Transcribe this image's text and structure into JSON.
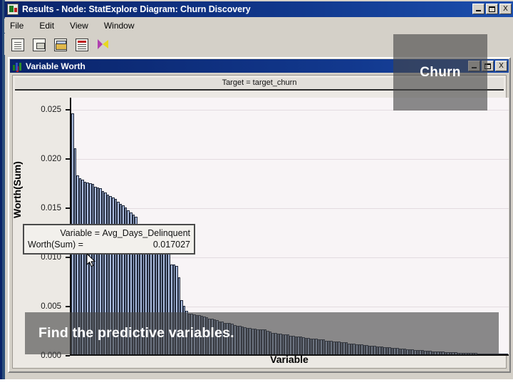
{
  "window": {
    "title": "Results - Node: StatExplore  Diagram: Churn Discovery",
    "icon": "results-node-icon",
    "buttons": {
      "minimize": "_",
      "maximize": "□",
      "close": "X"
    }
  },
  "menubar": {
    "items": [
      {
        "label": "File"
      },
      {
        "label": "Edit"
      },
      {
        "label": "View"
      },
      {
        "label": "Window"
      }
    ]
  },
  "toolbar": {
    "buttons": [
      {
        "name": "new-document-button",
        "icon": "document-icon"
      },
      {
        "name": "save-button",
        "icon": "save-icon"
      },
      {
        "name": "print-button",
        "icon": "printer-icon"
      },
      {
        "name": "table-view-button",
        "icon": "table-icon"
      },
      {
        "name": "run-button",
        "icon": "lightning-bolt-icon"
      }
    ]
  },
  "inner_window": {
    "title": "Variable Worth",
    "icon": "bar-chart-icon",
    "buttons": {
      "minimize": "_",
      "maximize": "□",
      "close": "X"
    }
  },
  "tooltip": {
    "variable_label": "Variable =",
    "variable_value": "Avg_Days_Delinquent",
    "worth_label": "Worth(Sum) =",
    "worth_value": "0.017027"
  },
  "overlays": [
    {
      "name": "overlay-churn",
      "text": "Churn",
      "color": "#464646"
    },
    {
      "name": "overlay-find-predictive",
      "text": "Find the predictive variables.",
      "color": "#464646"
    }
  ],
  "chart_data": {
    "type": "bar",
    "title": "Target = target_churn",
    "xlabel": "Variable",
    "ylabel": "Worth(Sum)",
    "ylim": [
      0,
      0.0262
    ],
    "yticks": [
      0.025,
      0.02,
      0.015,
      0.01,
      0.005,
      0.0
    ],
    "ytick_labels": [
      "0.025",
      "0.020",
      "0.015",
      "0.010",
      "0.005",
      "0.000"
    ],
    "grid": true,
    "legend": "none",
    "bar_color": "#a6b9dd",
    "bar_edge_color": "#20283a",
    "highlighted_bar": {
      "label": "Avg_Days_Delinquent",
      "value": 0.017027
    },
    "categories": [],
    "values": [
      0.0245,
      0.0209,
      0.0182,
      0.0179,
      0.01775,
      0.01755,
      0.01745,
      0.01735,
      0.01727,
      0.017027,
      0.01697,
      0.0169,
      0.0166,
      0.0164,
      0.0162,
      0.01605,
      0.0159,
      0.01575,
      0.0155,
      0.0153,
      0.0151,
      0.0149,
      0.01465,
      0.0144,
      0.0142,
      0.014,
      0.013,
      0.01285,
      0.01265,
      0.0125,
      0.0122,
      0.012,
      0.01185,
      0.0117,
      0.0116,
      0.0114,
      0.0104,
      0.0103,
      0.0102,
      0.00915,
      0.0091,
      0.009,
      0.0078,
      0.0055,
      0.0049,
      0.0044,
      0.00415,
      0.0041,
      0.00405,
      0.004,
      0.00395,
      0.0039,
      0.00385,
      0.0038,
      0.00365,
      0.0036,
      0.00355,
      0.0035,
      0.00335,
      0.0033,
      0.0032,
      0.0032,
      0.00315,
      0.0031,
      0.003,
      0.0029,
      0.0029,
      0.0028,
      0.00275,
      0.0027,
      0.0027,
      0.0026,
      0.0026,
      0.00255,
      0.0025,
      0.0025,
      0.0025,
      0.0024,
      0.0023,
      0.0022,
      0.0022,
      0.0021,
      0.0021,
      0.002,
      0.002,
      0.002,
      0.0019,
      0.0019,
      0.0018,
      0.0018,
      0.0018,
      0.00175,
      0.0017,
      0.0017,
      0.0016,
      0.0016,
      0.0016,
      0.0015,
      0.0015,
      0.0015,
      0.0014,
      0.0014,
      0.0014,
      0.0013,
      0.0013,
      0.0013,
      0.0012,
      0.0012,
      0.0012,
      0.0011,
      0.0011,
      0.0011,
      0.001,
      0.001,
      0.001,
      0.00095,
      0.00093,
      0.0009,
      0.00088,
      0.00085,
      0.00083,
      0.0008,
      0.00078,
      0.00075,
      0.00072,
      0.0007,
      0.00068,
      0.00065,
      0.00063,
      0.0006,
      0.00058,
      0.00055,
      0.00053,
      0.0005,
      0.00048,
      0.00046,
      0.00044,
      0.00042,
      0.0004,
      0.00038,
      0.00036,
      0.00034,
      0.00032,
      0.0003,
      0.00029,
      0.00027,
      0.00026,
      0.00024,
      0.00023,
      0.00021,
      0.0002,
      0.00019,
      0.00018,
      0.00017,
      0.00016,
      0.00015,
      0.00014,
      0.00013,
      0.00012,
      0.00011,
      0.0001,
      9e-05,
      8e-05,
      7e-05,
      6e-05,
      5e-05,
      4e-05,
      3e-05,
      2e-05,
      1e-05,
      1e-05,
      5e-06
    ]
  }
}
